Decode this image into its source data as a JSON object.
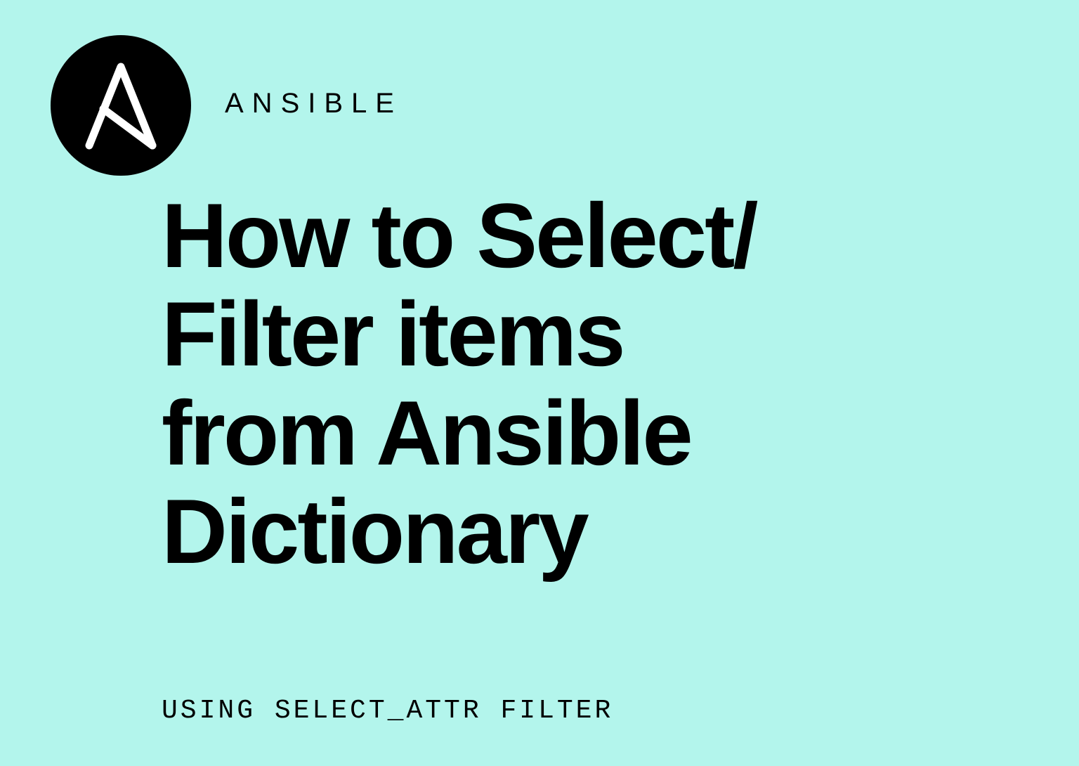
{
  "brand": {
    "name": "ANSIBLE",
    "logo_label": "Ansible Logo"
  },
  "content": {
    "title": "How to Select/\nFilter items\nfrom Ansible\nDictionary",
    "subtitle": "USING SELECT_ATTR FILTER"
  }
}
